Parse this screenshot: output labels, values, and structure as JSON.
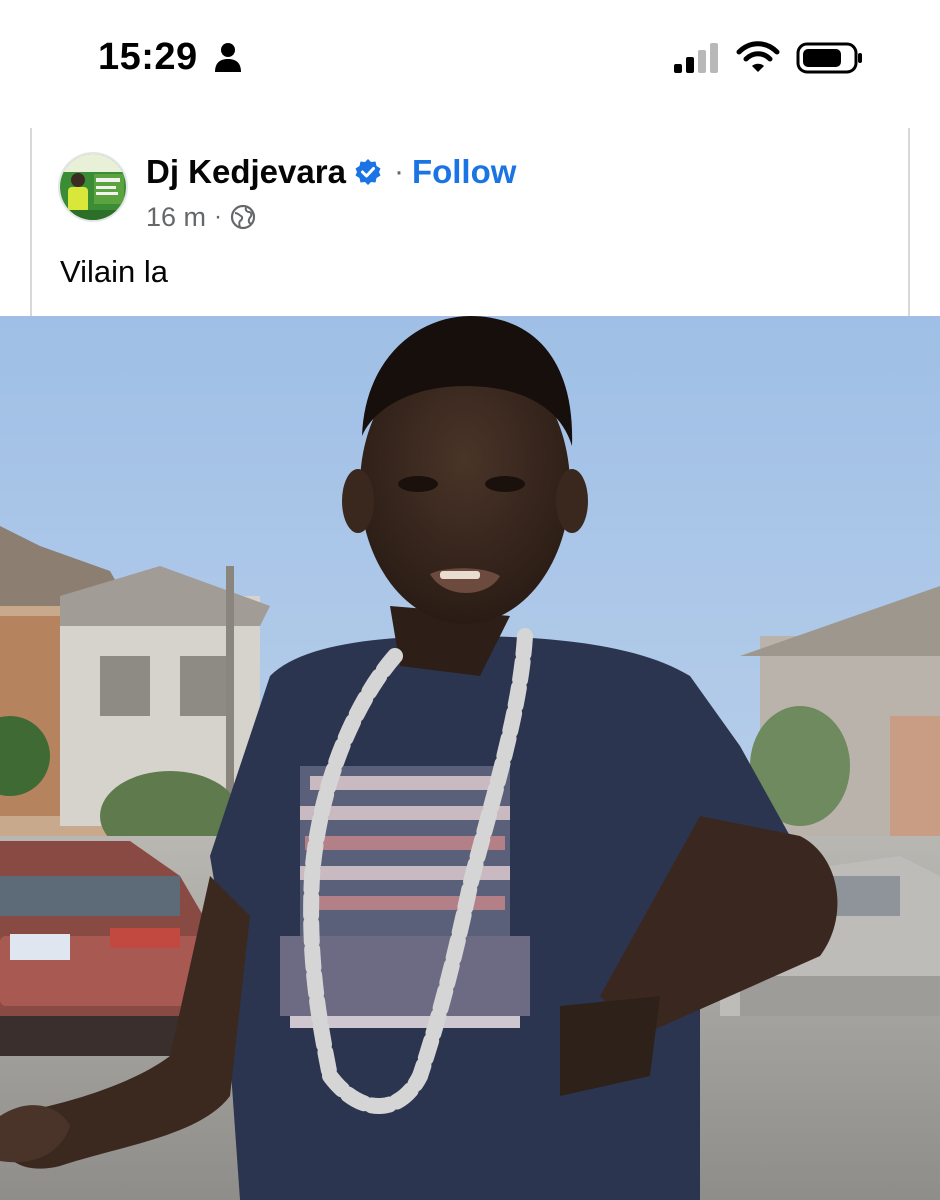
{
  "status_bar": {
    "time": "15:29",
    "icons": [
      "person-icon",
      "cellular-signal-icon",
      "wifi-icon",
      "battery-icon"
    ]
  },
  "post": {
    "author_name": "Dj Kedjevara",
    "verified_icon": "verified-badge-icon",
    "separator": "·",
    "follow_label": "Follow",
    "time": "16 m",
    "meta_separator": "·",
    "audience_icon": "globe-icon",
    "text": "Vilain la",
    "media": "photo"
  },
  "colors": {
    "accent": "#1b74e4",
    "secondary_text": "#65676b",
    "primary_text": "#050505"
  }
}
